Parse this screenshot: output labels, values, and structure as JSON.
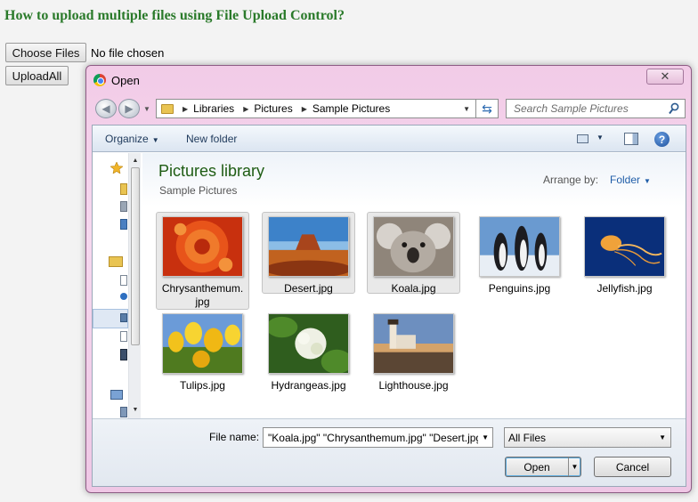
{
  "page": {
    "heading": "How to upload multiple files using File Upload Control?",
    "choose_files_label": "Choose Files",
    "no_file_text": "No file chosen",
    "upload_all_label": "UploadAll"
  },
  "dialog": {
    "title": "Open",
    "close_glyph": "✕",
    "breadcrumb": [
      "Libraries",
      "Pictures",
      "Sample Pictures"
    ],
    "search_placeholder": "Search Sample Pictures",
    "toolbar": {
      "organize": "Organize",
      "new_folder": "New folder"
    },
    "library": {
      "title": "Pictures library",
      "subtitle": "Sample Pictures",
      "arrange_label": "Arrange by:",
      "arrange_value": "Folder"
    },
    "files": [
      {
        "label": "Chrysanthemum.\njpg",
        "selected": true
      },
      {
        "label": "Desert.jpg",
        "selected": true
      },
      {
        "label": "Koala.jpg",
        "selected": true
      },
      {
        "label": "Penguins.jpg",
        "selected": false
      },
      {
        "label": "Jellyfish.jpg",
        "selected": false
      },
      {
        "label": "Tulips.jpg",
        "selected": false
      },
      {
        "label": "Hydrangeas.jpg",
        "selected": false
      },
      {
        "label": "Lighthouse.jpg",
        "selected": false
      }
    ],
    "file_name_label": "File name:",
    "file_name_value": "\"Koala.jpg\" \"Chrysanthemum.jpg\" \"Desert.jpg\"",
    "filter_value": "All Files",
    "open_label": "Open",
    "cancel_label": "Cancel"
  },
  "colors": {
    "heading": "#2a7a2a",
    "library_title": "#1e5c13",
    "link": "#1f5da8",
    "dialog_frame": "#f2cbe7"
  }
}
